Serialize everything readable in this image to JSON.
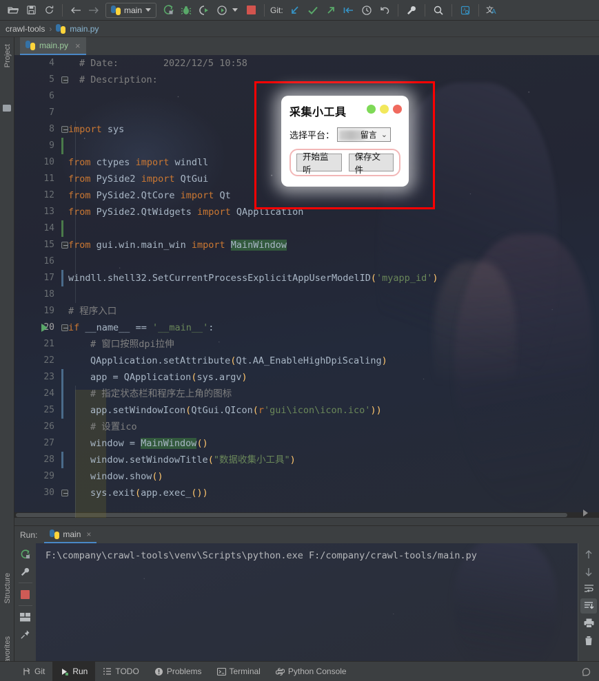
{
  "toolbar": {
    "buttons": [
      {
        "name": "open-folder-icon",
        "title": "Open"
      },
      {
        "name": "save-all-icon",
        "title": "Save All"
      },
      {
        "name": "sync-icon",
        "title": "Synchronize"
      },
      {
        "name": "back-arrow-icon",
        "title": "Back"
      },
      {
        "name": "forward-arrow-icon",
        "title": "Forward"
      }
    ],
    "run_config": "main",
    "run_icon": "run-icon",
    "debug_icon": "debug-icon",
    "run_with_coverage_icon": "run-with-coverage-icon",
    "profile_icon": "profile-icon",
    "stop_icon": "stop-icon",
    "git_label": "Git:",
    "git_update_icon": "git-update-project-icon",
    "git_commit_icon": "git-commit-icon",
    "git_push_icon": "git-push-icon",
    "git_pull_icon": "git-pull-icon",
    "history_icon": "history-icon",
    "undo_icon": "undo-icon",
    "settings_icon": "wrench-settings-icon",
    "search_icon": "search-everywhere-icon",
    "inspect_icon": "code-inspect-icon",
    "translate_icon": "translate-icon"
  },
  "breadcrumb": {
    "project": "crawl-tools",
    "separator": "›",
    "file": "main.py"
  },
  "left_stripe": {
    "project": "Project",
    "structure": "Structure",
    "favorites": "Favorites"
  },
  "editor_tab": {
    "label": "main.py",
    "close": "×"
  },
  "code": {
    "lines": [
      {
        "num": "4",
        "indent": 2,
        "html": "<span class=\"cm\"># Date:        2022/12/5 10:58</span>"
      },
      {
        "num": "5",
        "indent": 2,
        "html": "<span class=\"cm\"># Description:</span>",
        "fold": true
      },
      {
        "num": "6",
        "indent": 0,
        "html": ""
      },
      {
        "num": "7",
        "indent": 0,
        "html": ""
      },
      {
        "num": "8",
        "indent": 0,
        "html": "<span class=\"k\">import</span> <span class=\"n\">sys</span>",
        "fold": true
      },
      {
        "num": "9",
        "indent": 0,
        "html": "",
        "change": "green"
      },
      {
        "num": "10",
        "indent": 0,
        "html": "<span class=\"k\">from</span> <span class=\"n\">ctypes</span> <span class=\"k\">import</span> <span class=\"n\">windll</span>",
        "runmark": true
      },
      {
        "num": "11",
        "indent": 0,
        "html": "<span class=\"k\">from</span> <span class=\"n\">PySide2</span> <span class=\"k\">import</span> <span class=\"n\">QtGui</span>"
      },
      {
        "num": "12",
        "indent": 0,
        "html": "<span class=\"k\">from</span> <span class=\"n\">PySide2.QtCore</span> <span class=\"k\">import</span> <span class=\"n\">Qt</span>"
      },
      {
        "num": "13",
        "indent": 0,
        "html": "<span class=\"k\">from</span> <span class=\"n\">PySide2.QtWidgets</span> <span class=\"k\">import</span> <span class=\"n\">QApplication</span>"
      },
      {
        "num": "14",
        "indent": 0,
        "html": "",
        "change": "green"
      },
      {
        "num": "15",
        "indent": 0,
        "html": "<span class=\"k\">from</span> <span class=\"n\">gui.win.main_win</span> <span class=\"k\">import</span> <span class=\"hl n\">MainWindow</span>",
        "fold": true
      },
      {
        "num": "16",
        "indent": 0,
        "html": ""
      },
      {
        "num": "17",
        "indent": 0,
        "html": "<span class=\"n\">windll.shell32.SetCurrentProcessExplicitAppUserModelID</span><span class=\"f\">(</span><span class=\"s\">'myapp_id'</span><span class=\"f\">)</span>",
        "change": "blue"
      },
      {
        "num": "18",
        "indent": 0,
        "html": ""
      },
      {
        "num": "19",
        "indent": 0,
        "html": "<span class=\"cm\"># 程序入口</span>"
      },
      {
        "num": "20",
        "indent": 0,
        "html": "<span class=\"k\">if</span> <span class=\"n\">__name__</span> <span class=\"n\">==</span> <span class=\"s\">'__main__'</span><span class=\"n\">:</span>",
        "fold": true,
        "runarrow": true
      },
      {
        "num": "21",
        "indent": 4,
        "html": "<span class=\"cm\"># 窗口按照dpi拉伸</span>"
      },
      {
        "num": "22",
        "indent": 4,
        "html": "<span class=\"n\">QApplication.setAttribute</span><span class=\"f\">(</span><span class=\"n\">Qt.AA_EnableHighDpiScaling</span><span class=\"f\">)</span>"
      },
      {
        "num": "23",
        "indent": 4,
        "html": "<span class=\"n\">app = QApplication</span><span class=\"f\">(</span><span class=\"n\">sys.argv</span><span class=\"f\">)</span>",
        "change": "blue"
      },
      {
        "num": "24",
        "indent": 4,
        "html": "<span class=\"cm\"># 指定状态栏和程序左上角的图标</span>",
        "change": "blue"
      },
      {
        "num": "25",
        "indent": 4,
        "html": "<span class=\"n\">app.setWindowIcon</span><span class=\"f\">(</span><span class=\"n\">QtGui.QIcon</span><span class=\"f\">(</span><span class=\"k\">r</span><span class=\"s\">'gui\\icon\\icon.ico'</span><span class=\"f\">))</span>",
        "change": "blue"
      },
      {
        "num": "26",
        "indent": 4,
        "html": "<span class=\"cm\"># 设置ico</span>"
      },
      {
        "num": "27",
        "indent": 4,
        "html": "<span class=\"n\">window = </span><span class=\"hl n\">MainWindow</span><span class=\"f\">()</span>"
      },
      {
        "num": "28",
        "indent": 4,
        "html": "<span class=\"n\">window.setWindowTitle</span><span class=\"f\">(</span><span class=\"s\">\"数据收集小工具\"</span><span class=\"f\">)</span>",
        "change": "blue"
      },
      {
        "num": "29",
        "indent": 4,
        "html": "<span class=\"n\">window.show</span><span class=\"f\">()</span>"
      },
      {
        "num": "30",
        "indent": 4,
        "html": "<span class=\"n\">sys.exit</span><span class=\"f\">(</span><span class=\"n\">app.exec_</span><span class=\"f\">())</span>",
        "fold": true
      }
    ]
  },
  "dialog": {
    "title": "采集小工具",
    "dots": [
      {
        "name": "minimize-dot",
        "color": "#7ed957"
      },
      {
        "name": "maximize-dot",
        "color": "#f2e85c"
      },
      {
        "name": "close-dot",
        "color": "#f06a5e"
      }
    ],
    "platform_label": "选择平台：",
    "platform_value": "留言",
    "platform_arrow": "⌄",
    "start_button": "开始监听",
    "save_button": "保存文件",
    "highlight_color": "#ff0000"
  },
  "run_panel": {
    "label": "Run:",
    "tab": "main",
    "tab_close": "×",
    "console_output": "F:\\company\\crawl-tools\\venv\\Scripts\\python.exe F:/company/crawl-tools/main.py",
    "left_tools": [
      {
        "name": "rerun-icon"
      },
      {
        "name": "wrench-icon"
      },
      {
        "name": "stop-icon"
      },
      {
        "name": "layout-icon"
      },
      {
        "name": "pin-icon"
      }
    ],
    "right_tools": [
      {
        "name": "up-arrow-icon"
      },
      {
        "name": "down-arrow-icon"
      },
      {
        "name": "soft-wrap-icon"
      },
      {
        "name": "scroll-to-end-icon"
      },
      {
        "name": "print-icon"
      },
      {
        "name": "trash-icon"
      }
    ]
  },
  "statusbar": {
    "items": [
      {
        "label": "Git",
        "icon": "git-branch-icon",
        "active": false
      },
      {
        "label": "Run",
        "icon": "run-icon",
        "active": true
      },
      {
        "label": "TODO",
        "icon": "todo-list-icon",
        "active": false
      },
      {
        "label": "Problems",
        "icon": "problems-icon",
        "active": false
      },
      {
        "label": "Terminal",
        "icon": "terminal-icon",
        "active": false
      },
      {
        "label": "Python Console",
        "icon": "python-console-icon",
        "active": false
      }
    ],
    "right_icon": "event-log-icon"
  }
}
